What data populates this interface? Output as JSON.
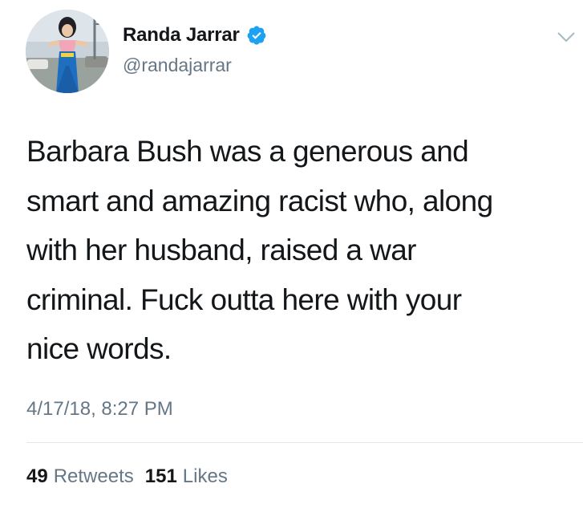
{
  "author": {
    "display_name": "Randa Jarrar",
    "handle": "@randajarrar",
    "verified_icon": "verified-badge-icon",
    "verified_color": "#1da1f2"
  },
  "tweet": {
    "text": "Barbara Bush was a generous and\nsmart and amazing racist who, along\nwith her husband, raised a war\ncriminal. Fuck outta here with your\nnice words.",
    "timestamp": "4/17/18, 8:27 PM"
  },
  "stats": {
    "retweets_count": "49",
    "retweets_label": "Retweets",
    "likes_count": "151",
    "likes_label": "Likes"
  },
  "menu": {
    "icon": "chevron-down-icon"
  },
  "colors": {
    "primary_text": "#14171a",
    "secondary_text": "#657786",
    "divider": "#e1e8ed"
  }
}
